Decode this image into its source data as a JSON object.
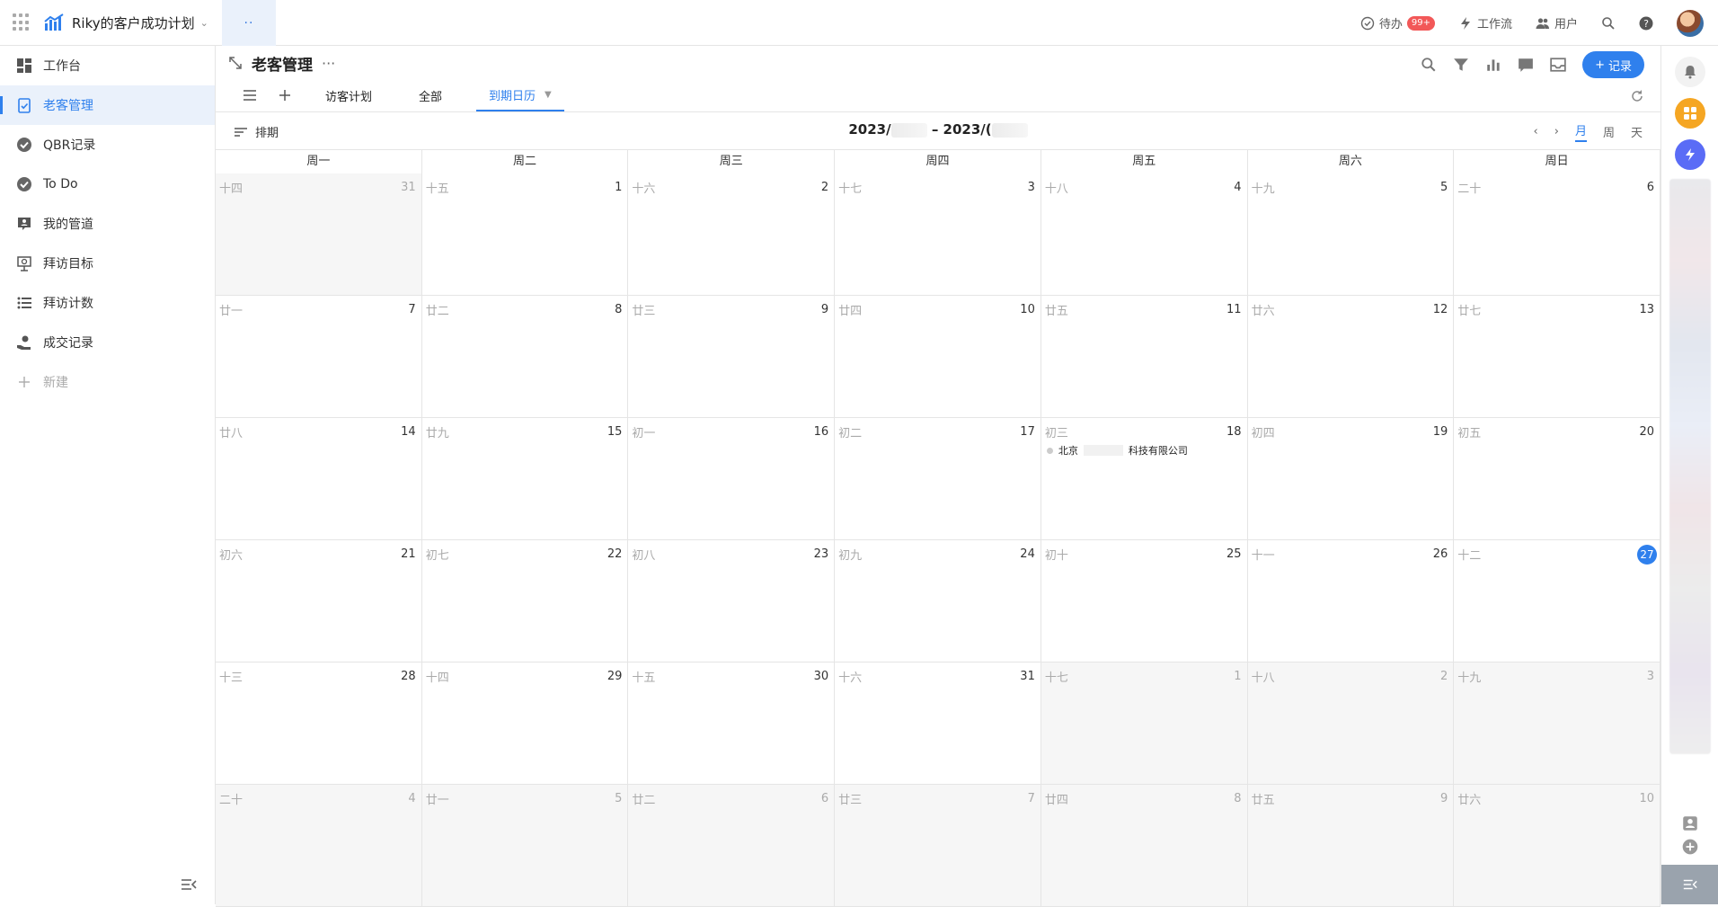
{
  "topbar": {
    "app_title": "Riky的客户成功计划",
    "tab_dots": "··",
    "todo_label": "待办",
    "todo_badge": "99+",
    "workflow_label": "工作流",
    "users_label": "用户"
  },
  "sidebar": {
    "items": [
      {
        "label": "工作台",
        "icon": "dashboard-icon"
      },
      {
        "label": "老客管理",
        "icon": "clipboard-check-icon"
      },
      {
        "label": "QBR记录",
        "icon": "check-circle-icon"
      },
      {
        "label": "To Do",
        "icon": "check-circle-icon"
      },
      {
        "label": "我的管道",
        "icon": "contact-card-icon"
      },
      {
        "label": "拜访目标",
        "icon": "presentation-icon"
      },
      {
        "label": "拜访计数",
        "icon": "list-icon"
      },
      {
        "label": "成交记录",
        "icon": "hand-coin-icon"
      },
      {
        "label": "新建",
        "icon": "plus-icon"
      }
    ]
  },
  "page": {
    "title": "老客管理",
    "record_button": "记录",
    "tabs": [
      "访客计划",
      "全部",
      "到期日历"
    ],
    "sort_label": "排期",
    "range_start": "2023/",
    "range_sep": "–",
    "range_end": "2023/(",
    "view_month": "月",
    "view_week": "周",
    "view_day": "天"
  },
  "calendar": {
    "weekdays": [
      "周一",
      "周二",
      "周三",
      "周四",
      "周五",
      "周六",
      "周日"
    ],
    "today": "27",
    "weeks": [
      [
        {
          "l": "十四",
          "d": "31",
          "o": true
        },
        {
          "l": "十五",
          "d": "1"
        },
        {
          "l": "十六",
          "d": "2"
        },
        {
          "l": "十七",
          "d": "3"
        },
        {
          "l": "十八",
          "d": "4"
        },
        {
          "l": "十九",
          "d": "5"
        },
        {
          "l": "二十",
          "d": "6"
        }
      ],
      [
        {
          "l": "廿一",
          "d": "7"
        },
        {
          "l": "廿二",
          "d": "8"
        },
        {
          "l": "廿三",
          "d": "9"
        },
        {
          "l": "廿四",
          "d": "10"
        },
        {
          "l": "廿五",
          "d": "11"
        },
        {
          "l": "廿六",
          "d": "12"
        },
        {
          "l": "廿七",
          "d": "13"
        }
      ],
      [
        {
          "l": "廿八",
          "d": "14"
        },
        {
          "l": "廿九",
          "d": "15"
        },
        {
          "l": "初一",
          "d": "16"
        },
        {
          "l": "初二",
          "d": "17"
        },
        {
          "l": "初三",
          "d": "18",
          "event_a": "北京",
          "event_b": "科技有限公司"
        },
        {
          "l": "初四",
          "d": "19"
        },
        {
          "l": "初五",
          "d": "20"
        }
      ],
      [
        {
          "l": "初六",
          "d": "21"
        },
        {
          "l": "初七",
          "d": "22"
        },
        {
          "l": "初八",
          "d": "23"
        },
        {
          "l": "初九",
          "d": "24"
        },
        {
          "l": "初十",
          "d": "25"
        },
        {
          "l": "十一",
          "d": "26"
        },
        {
          "l": "十二",
          "d": "27",
          "today": true
        }
      ],
      [
        {
          "l": "十三",
          "d": "28"
        },
        {
          "l": "十四",
          "d": "29"
        },
        {
          "l": "十五",
          "d": "30"
        },
        {
          "l": "十六",
          "d": "31"
        },
        {
          "l": "十七",
          "d": "1",
          "o": true
        },
        {
          "l": "十八",
          "d": "2",
          "o": true
        },
        {
          "l": "十九",
          "d": "3",
          "o": true
        }
      ],
      [
        {
          "l": "二十",
          "d": "4",
          "o": true
        },
        {
          "l": "廿一",
          "d": "5",
          "o": true
        },
        {
          "l": "廿二",
          "d": "6",
          "o": true
        },
        {
          "l": "廿三",
          "d": "7",
          "o": true
        },
        {
          "l": "廿四",
          "d": "8",
          "o": true
        },
        {
          "l": "廿五",
          "d": "9",
          "o": true
        },
        {
          "l": "廿六",
          "d": "10",
          "o": true
        }
      ]
    ]
  },
  "colors": {
    "accent": "#2f80ed",
    "badge": "#f25858",
    "orange": "#f5a623",
    "purple": "#6b5cf6"
  }
}
